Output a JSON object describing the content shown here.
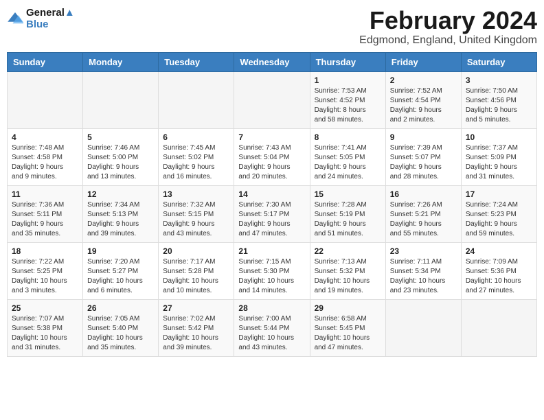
{
  "header": {
    "logo_line1": "General",
    "logo_line2": "Blue",
    "title": "February 2024",
    "subtitle": "Edgmond, England, United Kingdom"
  },
  "days_of_week": [
    "Sunday",
    "Monday",
    "Tuesday",
    "Wednesday",
    "Thursday",
    "Friday",
    "Saturday"
  ],
  "weeks": [
    [
      {
        "day": "",
        "info": ""
      },
      {
        "day": "",
        "info": ""
      },
      {
        "day": "",
        "info": ""
      },
      {
        "day": "",
        "info": ""
      },
      {
        "day": "1",
        "info": "Sunrise: 7:53 AM\nSunset: 4:52 PM\nDaylight: 8 hours\nand 58 minutes."
      },
      {
        "day": "2",
        "info": "Sunrise: 7:52 AM\nSunset: 4:54 PM\nDaylight: 9 hours\nand 2 minutes."
      },
      {
        "day": "3",
        "info": "Sunrise: 7:50 AM\nSunset: 4:56 PM\nDaylight: 9 hours\nand 5 minutes."
      }
    ],
    [
      {
        "day": "4",
        "info": "Sunrise: 7:48 AM\nSunset: 4:58 PM\nDaylight: 9 hours\nand 9 minutes."
      },
      {
        "day": "5",
        "info": "Sunrise: 7:46 AM\nSunset: 5:00 PM\nDaylight: 9 hours\nand 13 minutes."
      },
      {
        "day": "6",
        "info": "Sunrise: 7:45 AM\nSunset: 5:02 PM\nDaylight: 9 hours\nand 16 minutes."
      },
      {
        "day": "7",
        "info": "Sunrise: 7:43 AM\nSunset: 5:04 PM\nDaylight: 9 hours\nand 20 minutes."
      },
      {
        "day": "8",
        "info": "Sunrise: 7:41 AM\nSunset: 5:05 PM\nDaylight: 9 hours\nand 24 minutes."
      },
      {
        "day": "9",
        "info": "Sunrise: 7:39 AM\nSunset: 5:07 PM\nDaylight: 9 hours\nand 28 minutes."
      },
      {
        "day": "10",
        "info": "Sunrise: 7:37 AM\nSunset: 5:09 PM\nDaylight: 9 hours\nand 31 minutes."
      }
    ],
    [
      {
        "day": "11",
        "info": "Sunrise: 7:36 AM\nSunset: 5:11 PM\nDaylight: 9 hours\nand 35 minutes."
      },
      {
        "day": "12",
        "info": "Sunrise: 7:34 AM\nSunset: 5:13 PM\nDaylight: 9 hours\nand 39 minutes."
      },
      {
        "day": "13",
        "info": "Sunrise: 7:32 AM\nSunset: 5:15 PM\nDaylight: 9 hours\nand 43 minutes."
      },
      {
        "day": "14",
        "info": "Sunrise: 7:30 AM\nSunset: 5:17 PM\nDaylight: 9 hours\nand 47 minutes."
      },
      {
        "day": "15",
        "info": "Sunrise: 7:28 AM\nSunset: 5:19 PM\nDaylight: 9 hours\nand 51 minutes."
      },
      {
        "day": "16",
        "info": "Sunrise: 7:26 AM\nSunset: 5:21 PM\nDaylight: 9 hours\nand 55 minutes."
      },
      {
        "day": "17",
        "info": "Sunrise: 7:24 AM\nSunset: 5:23 PM\nDaylight: 9 hours\nand 59 minutes."
      }
    ],
    [
      {
        "day": "18",
        "info": "Sunrise: 7:22 AM\nSunset: 5:25 PM\nDaylight: 10 hours\nand 3 minutes."
      },
      {
        "day": "19",
        "info": "Sunrise: 7:20 AM\nSunset: 5:27 PM\nDaylight: 10 hours\nand 6 minutes."
      },
      {
        "day": "20",
        "info": "Sunrise: 7:17 AM\nSunset: 5:28 PM\nDaylight: 10 hours\nand 10 minutes."
      },
      {
        "day": "21",
        "info": "Sunrise: 7:15 AM\nSunset: 5:30 PM\nDaylight: 10 hours\nand 14 minutes."
      },
      {
        "day": "22",
        "info": "Sunrise: 7:13 AM\nSunset: 5:32 PM\nDaylight: 10 hours\nand 19 minutes."
      },
      {
        "day": "23",
        "info": "Sunrise: 7:11 AM\nSunset: 5:34 PM\nDaylight: 10 hours\nand 23 minutes."
      },
      {
        "day": "24",
        "info": "Sunrise: 7:09 AM\nSunset: 5:36 PM\nDaylight: 10 hours\nand 27 minutes."
      }
    ],
    [
      {
        "day": "25",
        "info": "Sunrise: 7:07 AM\nSunset: 5:38 PM\nDaylight: 10 hours\nand 31 minutes."
      },
      {
        "day": "26",
        "info": "Sunrise: 7:05 AM\nSunset: 5:40 PM\nDaylight: 10 hours\nand 35 minutes."
      },
      {
        "day": "27",
        "info": "Sunrise: 7:02 AM\nSunset: 5:42 PM\nDaylight: 10 hours\nand 39 minutes."
      },
      {
        "day": "28",
        "info": "Sunrise: 7:00 AM\nSunset: 5:44 PM\nDaylight: 10 hours\nand 43 minutes."
      },
      {
        "day": "29",
        "info": "Sunrise: 6:58 AM\nSunset: 5:45 PM\nDaylight: 10 hours\nand 47 minutes."
      },
      {
        "day": "",
        "info": ""
      },
      {
        "day": "",
        "info": ""
      }
    ]
  ]
}
